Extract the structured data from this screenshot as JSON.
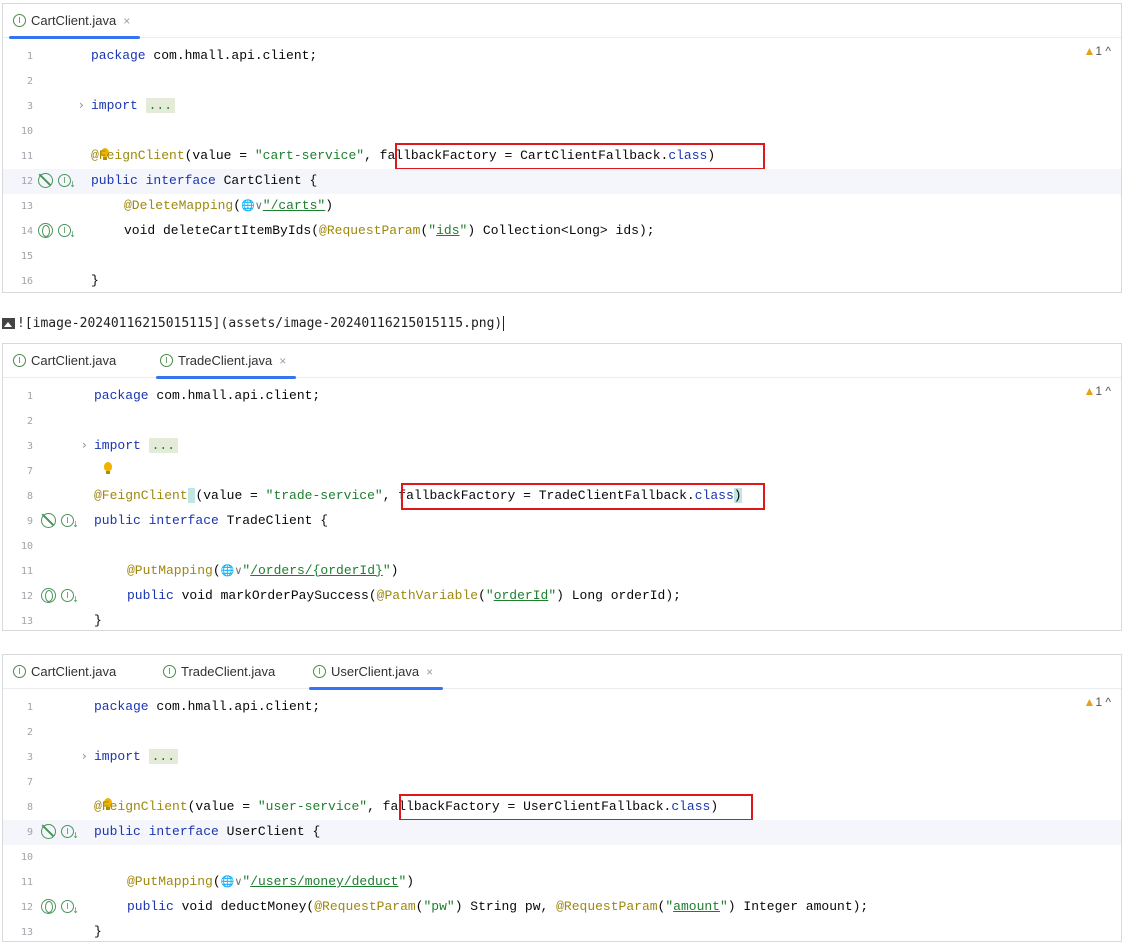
{
  "panel1": {
    "tabs": [
      {
        "label": "CartClient.java",
        "close": "×"
      }
    ],
    "warning": "1 ^",
    "lines": {
      "l1": {
        "n": "1",
        "kw": "package",
        "rest": " com.hmall.api.client;"
      },
      "l2": {
        "n": "2"
      },
      "l3": {
        "n": "3",
        "kw": "import",
        "fold": "..."
      },
      "l10": {
        "n": "10"
      },
      "l11": {
        "n": "11",
        "ann": "@FeignClient",
        "p1": "(value = ",
        "str": "\"cart-service\"",
        "p2": ", fallbackFactory = CartClientFallback.",
        "kw": "class",
        "p3": ")"
      },
      "l12": {
        "n": "12",
        "kw": "public interface",
        "rest": " CartClient {"
      },
      "l13": {
        "n": "13",
        "ann": "@DeleteMapping",
        "p1": "(",
        "globe": "🌐∨",
        "str": "\"/carts\"",
        "p2": ")"
      },
      "l14": {
        "n": "14",
        "p1": "void deleteCartItemByIds(",
        "ann": "@RequestParam",
        "p2": "(",
        "str1": "\"",
        "link": "ids",
        "str2": "\"",
        "p3": ") Collection<Long> ids);"
      },
      "l15": {
        "n": "15"
      },
      "l16": {
        "n": "16",
        "rest": "}"
      }
    }
  },
  "markdown": {
    "text": "![image-20240116215015115](assets/image-20240116215015115.png)"
  },
  "panel2": {
    "tabs": [
      {
        "label": "CartClient.java"
      },
      {
        "label": "TradeClient.java",
        "close": "×"
      }
    ],
    "warning": "1 ^",
    "lines": {
      "l1": {
        "n": "1",
        "kw": "package",
        "rest": " com.hmall.api.client;"
      },
      "l2": {
        "n": "2"
      },
      "l3": {
        "n": "3",
        "kw": "import",
        "fold": "..."
      },
      "l7": {
        "n": "7"
      },
      "l8": {
        "n": "8",
        "ann": "@FeignClient",
        "p1": "(value = ",
        "str": "\"trade-service\"",
        "p2": ", fallbackFactory = TradeClientFallback.",
        "kw": "class",
        "p3": ")"
      },
      "l9": {
        "n": "9",
        "kw": "public interface",
        "rest": " TradeClient {"
      },
      "l10": {
        "n": "10"
      },
      "l11": {
        "n": "11",
        "ann": "@PutMapping",
        "p1": "(",
        "globe": "🌐∨",
        "str1": "\"",
        "link": "/orders/{orderId}",
        "str2": "\"",
        "p2": ")"
      },
      "l12": {
        "n": "12",
        "kw": "public",
        "p1": " void markOrderPaySuccess(",
        "ann": "@PathVariable",
        "p2": "(",
        "str1": "\"",
        "link": "orderId",
        "str2": "\"",
        "p3": ") Long orderId);"
      },
      "l13": {
        "n": "13",
        "rest": "}"
      }
    }
  },
  "panel3": {
    "tabs": [
      {
        "label": "CartClient.java"
      },
      {
        "label": "TradeClient.java"
      },
      {
        "label": "UserClient.java",
        "close": "×"
      }
    ],
    "warning": "1 ^",
    "lines": {
      "l1": {
        "n": "1",
        "kw": "package",
        "rest": " com.hmall.api.client;"
      },
      "l2": {
        "n": "2"
      },
      "l3": {
        "n": "3",
        "kw": "import",
        "fold": "..."
      },
      "l7": {
        "n": "7"
      },
      "l8": {
        "n": "8",
        "ann": "@FeignClient",
        "p1": "(value = ",
        "str": "\"user-service\"",
        "p2": ", fallbackFactory = UserClientFallback.",
        "kw": "class",
        "p3": ")"
      },
      "l9": {
        "n": "9",
        "kw": "public interface",
        "rest": " UserClient {"
      },
      "l10": {
        "n": "10"
      },
      "l11": {
        "n": "11",
        "ann": "@PutMapping",
        "p1": "(",
        "globe": "🌐∨",
        "str1": "\"",
        "link": "/users/money/deduct",
        "str2": "\"",
        "p2": ")"
      },
      "l12": {
        "n": "12",
        "kw": "public",
        "p1": " void deductMoney(",
        "ann1": "@RequestParam",
        "p2": "(",
        "str1": "\"pw\"",
        "p3": ") String pw, ",
        "ann2": "@RequestParam",
        "p4": "(",
        "str2": "\"",
        "link": "amount",
        "str3": "\"",
        "p5": ") Integer amount);"
      },
      "l13": {
        "n": "13",
        "rest": "}"
      }
    }
  }
}
